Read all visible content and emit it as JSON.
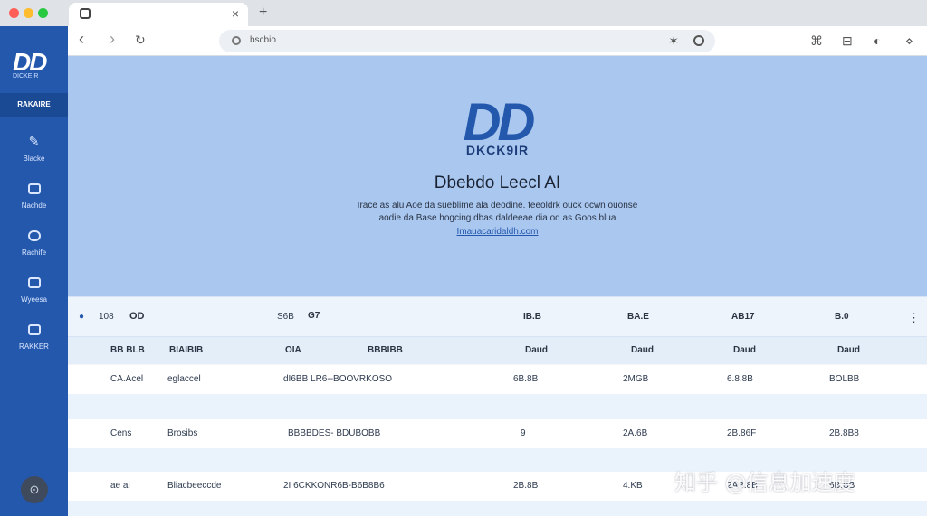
{
  "window": {
    "tab_title": "",
    "close_tab": "×",
    "new_tab": "+",
    "controls": {
      "close_color": "#ff5f57",
      "minimize_color": "#febc2e",
      "maximize_color": "#28c840"
    }
  },
  "toolbar": {
    "back": "‹",
    "forward": "›",
    "reload": "↻",
    "url": "bscbio",
    "star": "✶",
    "ext1": "⌘",
    "ext2": "⊟",
    "ext3": "◐",
    "ext4": "⋄"
  },
  "sidebar": {
    "logo": "DD",
    "logo_sub": "DICKEIR",
    "active_item": "RAKAIRE",
    "items": [
      {
        "label": "Blacke",
        "icon": "pen-icon"
      },
      {
        "label": "Nachde",
        "icon": "image-icon"
      },
      {
        "label": "Rachife",
        "icon": "chat-icon"
      },
      {
        "label": "Wyeesa",
        "icon": "book-icon"
      },
      {
        "label": "RAKKER",
        "icon": "mail-icon"
      }
    ],
    "avatar_glyph": "⊙"
  },
  "hero": {
    "logo": "DD",
    "logo_sub": "DKCK9IR",
    "title": "Dbebdo Leecl AI",
    "desc_line1": "Irace as alu Aoe da sueblime ala deodine. feeoldrk ouck ocwn ouonse",
    "desc_line2": "aodie da Base hogcing dbas daldeeae dia od as Goos blua",
    "link": "Imauacaridaldh.com"
  },
  "table": {
    "filter_icon_label": "108",
    "filter_toggle": "OD",
    "col_a": "S6B",
    "col_b": "G7",
    "col_c": "IB.B",
    "col_d": "BA.E",
    "col_e": "AB17",
    "col_f": "B.0",
    "more": "⋮",
    "headers": [
      "BB BLB",
      "BIAIBIB",
      "OIA",
      "BBBIBB",
      "Daud",
      "Daud",
      "Daud",
      "Daud"
    ],
    "rows": [
      [
        "CA.Acel",
        "eglaccel",
        "dI6BB LR6--BOOVRKOSO",
        "6B.8B",
        "2MGB",
        "6.8.8B",
        "BOLBB"
      ],
      [
        "Cens",
        "Brosibs",
        "BBBBDES- BDUBOBB",
        "9",
        "2A.6B",
        "2B.86F",
        "2B.8B8"
      ],
      [
        "ae al",
        "Bliacbeeccde",
        "2I 6CKKONR6B-B6B8B6",
        "2B.8B",
        "4.KB",
        "2AB.8B",
        "6B.BB"
      ]
    ]
  },
  "watermark": "知乎 @信息加速度"
}
